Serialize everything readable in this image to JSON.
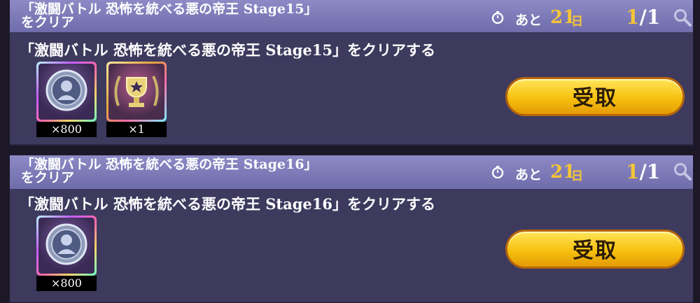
{
  "missions": [
    {
      "title": "「激闘バトル 恐怖を統べる悪の帝王 Stage15」\nをクリア",
      "remaining_prefix": "あと",
      "remaining_days": "21",
      "remaining_unit": "日",
      "progress_current": "1",
      "progress_total": "/1",
      "description": "「激闘バトル 恐怖を統べる悪の帝王 Stage15」をクリアする",
      "rewards": [
        {
          "count": "×800",
          "icon": "medal-coin-icon"
        },
        {
          "count": "×1",
          "icon": "trophy-icon"
        }
      ],
      "claim_label": "受取"
    },
    {
      "title": "「激闘バトル 恐怖を統べる悪の帝王 Stage16」\nをクリア",
      "remaining_prefix": "あと",
      "remaining_days": "21",
      "remaining_unit": "日",
      "progress_current": "1",
      "progress_total": "/1",
      "description": "「激闘バトル 恐怖を統べる悪の帝王 Stage16」をクリアする",
      "rewards": [
        {
          "count": "×800",
          "icon": "medal-coin-icon"
        }
      ],
      "claim_label": "受取"
    }
  ],
  "colors": {
    "header": "#7d7aba",
    "card": "#3d3a5e",
    "accent_gold": "#f5c43a",
    "button": "#f7c10e"
  }
}
